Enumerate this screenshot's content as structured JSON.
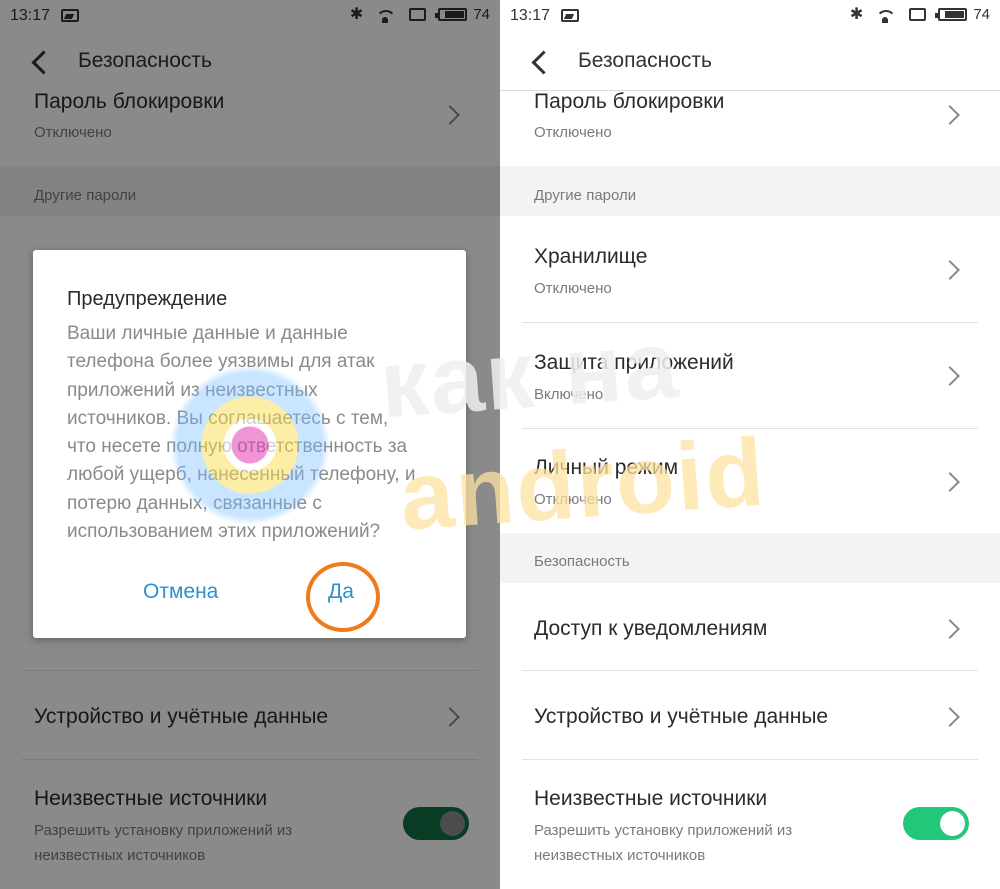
{
  "status_bar": {
    "time": "13:17",
    "battery_level": "74"
  },
  "header": {
    "title": "Безопасность"
  },
  "items": {
    "lock_password": {
      "title": "Пароль блокировки",
      "status": "Отключено"
    },
    "storage": {
      "title": "Хранилище",
      "status": "Отключено"
    },
    "app_protection": {
      "title": "Защита приложений",
      "status": "Включено"
    },
    "private_mode": {
      "title": "Личный режим",
      "status": "Отключено"
    },
    "notification_access": {
      "title": "Доступ к уведомлениям"
    },
    "device_accounts": {
      "title": "Устройство и учётные данные"
    },
    "unknown_sources": {
      "title": "Неизвестные источники",
      "description_line1": "Разрешить установку приложений из",
      "description_line2": "неизвестных источников",
      "enabled": true
    }
  },
  "sections": {
    "other_passwords": "Другие пароли",
    "security": "Безопасность"
  },
  "dialog": {
    "title": "Предупреждение",
    "lines": [
      "Ваши личные данные и данные",
      "телефона более уязвимы для атак",
      "приложений из неизвестных",
      "источников. Вы соглашаетесь с тем,",
      "что несете полную ответственность за",
      "любой ущерб, нанесенный телефону, и",
      "потерю данных, связанные с",
      "использованием этих приложений?"
    ],
    "cancel_label": "Отмена",
    "confirm_label": "Да"
  },
  "watermark": {
    "line1": "как на",
    "line2": "android"
  },
  "colors": {
    "toggle_on": "#23c77a",
    "accent": "#2f8fd0",
    "highlight": "#f07b1a"
  }
}
